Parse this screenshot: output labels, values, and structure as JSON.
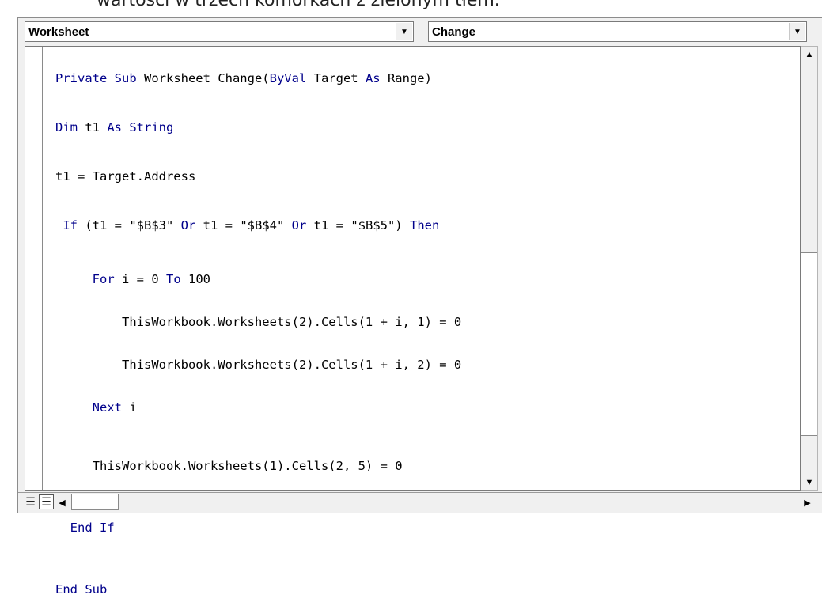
{
  "caption": "wartości w trzech komórkach z zielonym tłem.",
  "dropdowns": {
    "object": {
      "value": "Worksheet"
    },
    "procedure": {
      "value": "Change"
    }
  },
  "code_lines": {
    "l1": {
      "kw1": "Private Sub",
      "rest": " Worksheet_Change(",
      "kw2": "ByVal",
      "rest2": " Target ",
      "kw3": "As",
      "rest3": " Range)"
    },
    "l2": {
      "kw1": "Dim",
      "rest": " t1 ",
      "kw2": "As",
      "kw3": " String"
    },
    "l3": {
      "text": "t1 = Target.Address"
    },
    "l4": {
      "kw1": " If",
      "rest": " (t1 = \"$B$3\" ",
      "or1": "Or",
      "rest2": " t1 = \"$B$4\" ",
      "or2": "Or",
      "rest3": " t1 = \"$B$5\") ",
      "kw2": "Then"
    },
    "l5": {
      "kw1": "     For",
      "rest": " i = 0 ",
      "kw2": "To",
      "rest2": " 100"
    },
    "l6": {
      "text": "         ThisWorkbook.Worksheets(2).Cells(1 + i, 1) = 0"
    },
    "l7": {
      "text": "         ThisWorkbook.Worksheets(2).Cells(1 + i, 2) = 0"
    },
    "l8": {
      "kw1": "     Next",
      "rest": " i"
    },
    "l9": {
      "text": "     ThisWorkbook.Worksheets(1).Cells(2, 5) = 0"
    },
    "l10": {
      "kw1": "  End If"
    },
    "l11": {
      "kw1": "End Sub"
    }
  },
  "icons": {
    "dropdown_arrow": "▼",
    "scroll_up": "▲",
    "scroll_down": "▼",
    "scroll_left": "◀",
    "scroll_right": "▶",
    "procedure_view": "☰",
    "full_module_view": "☰"
  },
  "colors": {
    "keyword": "#00008b",
    "text": "#000000"
  }
}
